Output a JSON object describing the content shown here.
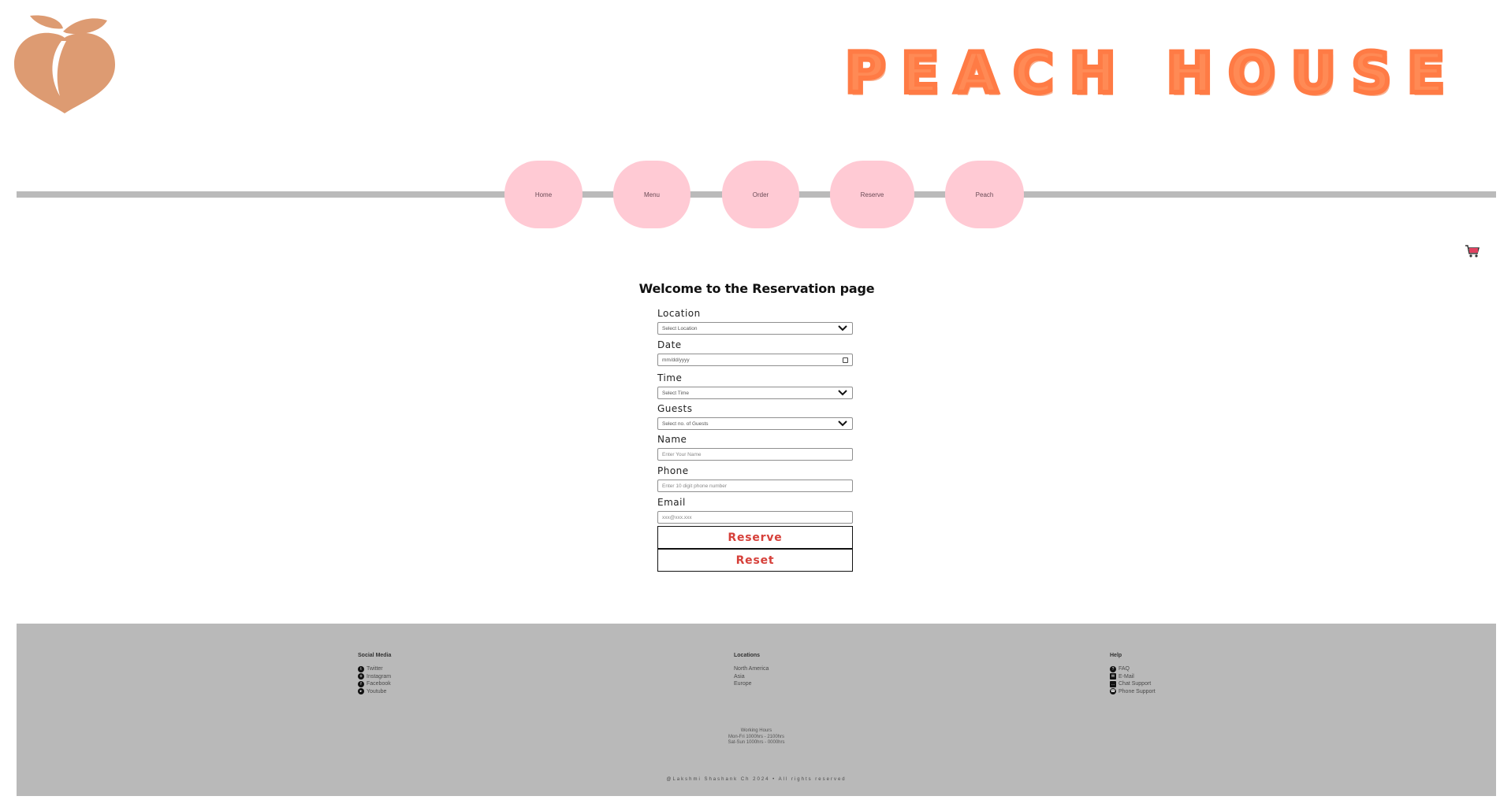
{
  "brand": {
    "title": "PEACH HOUSE",
    "accent": "#ff8a55",
    "logo_color": "#dd9b72"
  },
  "nav": {
    "items": [
      {
        "label": "Home"
      },
      {
        "label": "Menu"
      },
      {
        "label": "Order"
      },
      {
        "label": "Reserve"
      },
      {
        "label": "Peach"
      }
    ],
    "pill_color": "#ffcad4",
    "cart_icon": "shopping-cart-icon"
  },
  "form": {
    "title": "Welcome to the Reservation page",
    "location": {
      "label": "Location",
      "value": "Select Location"
    },
    "date": {
      "label": "Date",
      "value": "mm/dd/yyyy"
    },
    "time": {
      "label": "Time",
      "value": "Select Time"
    },
    "guests": {
      "label": "Guests",
      "value": "Select no. of Guests"
    },
    "name": {
      "label": "Name",
      "placeholder": "Enter Your Name"
    },
    "phone": {
      "label": "Phone",
      "placeholder": "Enter 10 digit phone number"
    },
    "email": {
      "label": "Email",
      "placeholder": "xxx@xxx.xxx"
    },
    "reserve_label": "Reserve",
    "reset_label": "Reset",
    "button_text_color": "#d6403a"
  },
  "footer": {
    "social": {
      "heading": "Social Media",
      "items": [
        {
          "label": "Twitter",
          "icon": "twitter-icon"
        },
        {
          "label": "Instagram",
          "icon": "instagram-icon"
        },
        {
          "label": "Facebook",
          "icon": "facebook-icon"
        },
        {
          "label": "Youtube",
          "icon": "youtube-icon"
        }
      ]
    },
    "locations": {
      "heading": "Locations",
      "items": [
        "North America",
        "Asia",
        "Europe"
      ]
    },
    "help": {
      "heading": "Help",
      "items": [
        {
          "label": "FAQ",
          "icon": "question-icon"
        },
        {
          "label": "E-Mail",
          "icon": "mail-icon"
        },
        {
          "label": "Chat Support",
          "icon": "chat-icon"
        },
        {
          "label": "Phone Support",
          "icon": "phone-icon"
        }
      ]
    },
    "hours": {
      "title": "Working Hours",
      "weekdays": "Mon-Fri 1000hrs - 2100hrs",
      "weekend": "Sat-Sun 1000hrs - 0000hrs"
    },
    "copyright": "@Lakshmi Shashank Ch 2024 • All rights reserved",
    "background": "#b9b9b9"
  }
}
